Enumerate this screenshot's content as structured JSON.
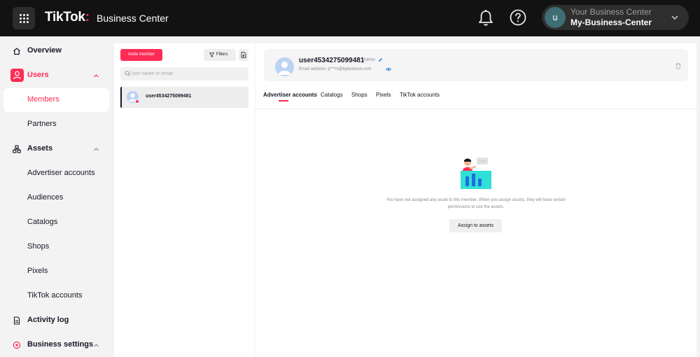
{
  "header": {
    "brand": "TikTok",
    "brand_sub": "Business Center",
    "account_line1": "Your Business Center",
    "account_line2": "My-Business-Center",
    "account_initial": "u"
  },
  "sidebar": {
    "items": [
      {
        "label": "Overview",
        "icon": "home-icon"
      },
      {
        "label": "Users",
        "icon": "users-icon"
      },
      {
        "label": "Members"
      },
      {
        "label": "Partners"
      },
      {
        "label": "Assets",
        "icon": "assets-icon"
      },
      {
        "label": "Advertiser accounts"
      },
      {
        "label": "Audiences"
      },
      {
        "label": "Catalogs"
      },
      {
        "label": "Shops"
      },
      {
        "label": "Pixels"
      },
      {
        "label": "TikTok accounts"
      },
      {
        "label": "Activity log",
        "icon": "log-icon"
      },
      {
        "label": "Business settings",
        "icon": "settings-icon"
      }
    ]
  },
  "members": {
    "invite_label": "Invite member",
    "filters_label": "Filters",
    "search_placeholder": "User name or email",
    "list": [
      {
        "name": "user4534275099481"
      }
    ]
  },
  "detail": {
    "username": "user4534275099481",
    "role": "Admin",
    "email": "Email address: p***m@bytedance.com",
    "tabs": [
      "Advertiser accounts",
      "Catalogs",
      "Shops",
      "Pixels",
      "TikTok accounts"
    ],
    "empty_message": "You have not assigned any asset to this member. When you assign assets, they will have certain permissions to use the assets.",
    "assign_label": "Assign to assets"
  },
  "colors": {
    "accent": "#fe2c55",
    "header_bg": "#121212"
  }
}
